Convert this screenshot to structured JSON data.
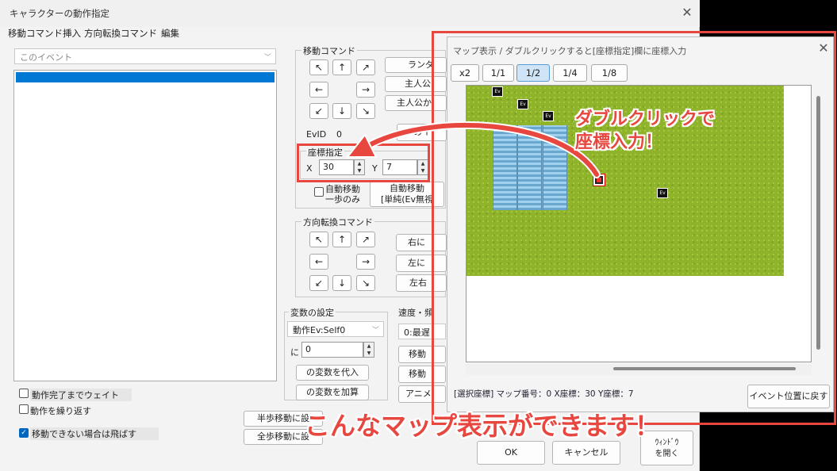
{
  "window": {
    "title": "キャラクターの動作指定"
  },
  "menu": [
    "移動コマンド挿入",
    "方向転換コマンド",
    "編集"
  ],
  "target_combo": {
    "value": "このイベント"
  },
  "options": {
    "wait": "動作完了までウェイト",
    "repeat": "動作を繰り返す",
    "skip": "移動できない場合は飛ばす"
  },
  "move_group": {
    "label": "移動コマンド",
    "dirs": [
      "↖",
      "↑",
      "↗",
      "←",
      "→",
      "↙",
      "↓",
      "↘"
    ],
    "btns": [
      "ランダ",
      "主人公",
      "主人公か"
    ],
    "evid_label": "EvID",
    "evid_value": "0",
    "ev_btn": "のイ"
  },
  "coord": {
    "label": "座標指定",
    "x_label": "X",
    "x_value": "30",
    "y_label": "Y",
    "y_value": "7"
  },
  "auto": {
    "label": "自動移動\n一歩のみ",
    "btn2": "自動移動\n[単純(Ev無視"
  },
  "dir_group": {
    "label": "方向転換コマンド",
    "dirs": [
      "↖",
      "↑",
      "↗",
      "←",
      "→",
      "↙",
      "↓",
      "↘"
    ],
    "btns": [
      "右に",
      "左に",
      "左右"
    ]
  },
  "var_group": {
    "label": "変数の設定",
    "select": "動作Ev:Self0",
    "ni": "に",
    "value": "0",
    "assign": "の変数を代入",
    "add": "の変数を加算"
  },
  "speed_group": {
    "label": "速度・頻",
    "select": "0:最遅",
    "btns": [
      "移動",
      "移動",
      "アニメ"
    ]
  },
  "bottom": {
    "half": "半歩移動に設",
    "full": "全歩移動に設",
    "ok": "OK",
    "cancel": "キャンセル",
    "map_win": "ｳｨﾝﾄﾞｳ\nを開く"
  },
  "map_window": {
    "title": "マップ表示 / ダブルクリックすると[座標指定]欄に座標入力",
    "tabs": [
      "x2",
      "1/1",
      "1/2",
      "1/4",
      "1/8"
    ],
    "active_tab": "1/2",
    "ev_label": "Ev",
    "status": "[選択座標] マップ番号：0  X座標：30  Y座標：7",
    "return_btn": "イベント位置に戻す"
  },
  "annotations": {
    "callout1": "ダブルクリックで\n座標入力！",
    "callout2": "こんなマップ表示ができます！"
  },
  "colors": {
    "accent": "#e8473f",
    "selection": "#0078d4",
    "grass": "#8fb32a"
  }
}
